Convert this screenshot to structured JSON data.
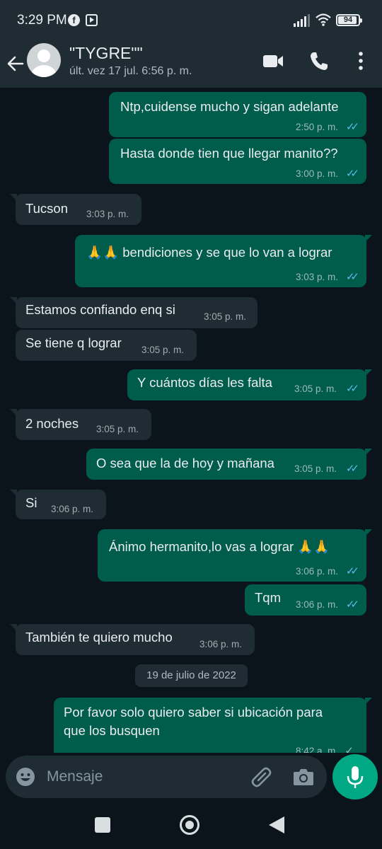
{
  "status_bar": {
    "time": "3:29 PM",
    "battery": "94",
    "icons": [
      "facebook-icon",
      "media-app-icon",
      "signal-icon",
      "wifi-icon",
      "battery-icon"
    ]
  },
  "header": {
    "contact_name": "\"TYGRE\"\"",
    "last_seen": "últ. vez 17 jul. 6:56 p. m.",
    "icons": [
      "back-arrow-icon",
      "video-call-icon",
      "phone-icon",
      "more-options-icon"
    ]
  },
  "messages": [
    {
      "dir": "out",
      "text": "Ntp,cuidense mucho y sigan adelante",
      "time": "2:50 p. m.",
      "status": "read"
    },
    {
      "dir": "out",
      "text": "Hasta donde tien que llegar manito??",
      "time": "3:00 p. m.",
      "status": "read"
    },
    {
      "dir": "in",
      "text": "Tucson",
      "time": "3:03 p. m."
    },
    {
      "dir": "out",
      "text": "🙏🙏 bendiciones y se que lo van a lograr",
      "time": "3:03 p. m.",
      "status": "read"
    },
    {
      "dir": "in",
      "text": "Estamos confiando enq si",
      "time": "3:05 p. m."
    },
    {
      "dir": "in",
      "text": "Se tiene q lograr",
      "time": "3:05 p. m."
    },
    {
      "dir": "out",
      "text": "Y cuántos días les falta",
      "time": "3:05 p. m.",
      "status": "read"
    },
    {
      "dir": "in",
      "text": "2 noches",
      "time": "3:05 p. m."
    },
    {
      "dir": "out",
      "text": "O sea que la de hoy y mañana",
      "time": "3:05 p. m.",
      "status": "read"
    },
    {
      "dir": "in",
      "text": "Si",
      "time": "3:06 p. m."
    },
    {
      "dir": "out",
      "text": "Ánimo hermanito,lo vas a lograr 🙏🙏",
      "time": "3:06 p. m.",
      "status": "read"
    },
    {
      "dir": "out",
      "text": "Tqm",
      "time": "3:06 p. m.",
      "status": "read"
    },
    {
      "dir": "in",
      "text": "También te quiero mucho",
      "time": "3:06 p. m."
    },
    {
      "dir": "out",
      "text": "Por favor solo quiero saber si ubicación para que los busquen",
      "time": "8:42 a. m.",
      "status": "sent"
    }
  ],
  "date_separator": "19 de julio de 2022",
  "composer": {
    "placeholder": "Mensaje"
  },
  "colors": {
    "outgoing_bubble": "#005c4b",
    "incoming_bubble": "#1f2c34",
    "accent": "#00a884",
    "read_ticks": "#53bdeb",
    "background": "#0b141a"
  }
}
